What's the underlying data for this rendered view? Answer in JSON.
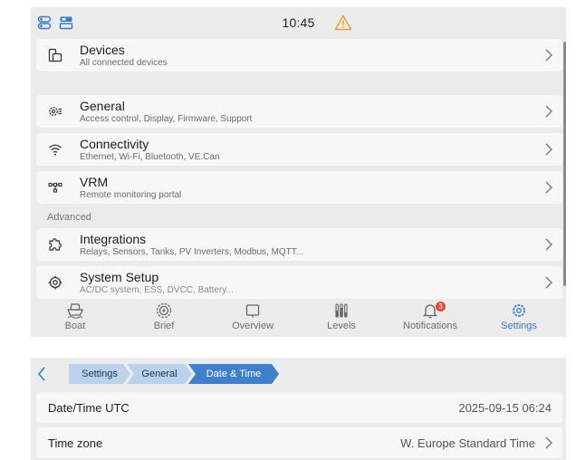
{
  "status_bar": {
    "time": "10:45",
    "icons": [
      "toggle-switches-icon",
      "panel-layout-icon",
      "warning-triangle-icon"
    ],
    "warning_color": "#f0a030"
  },
  "menu": {
    "devices": {
      "title": "Devices",
      "subtitle": "All connected devices",
      "icon": "devices-icon"
    },
    "general": {
      "title": "General",
      "subtitle": "Access control, Display, Firmware, Support",
      "icon": "gear-list-icon"
    },
    "connectivity": {
      "title": "Connectivity",
      "subtitle": "Ethernet, Wi-Fi, Bluetooth, VE.Can",
      "icon": "wifi-icon"
    },
    "vrm": {
      "title": "VRM",
      "subtitle": "Remote monitoring portal",
      "icon": "network-icon"
    },
    "advanced_label": "Advanced",
    "integrations": {
      "title": "Integrations",
      "subtitle": "Relays, Sensors, Tanks, PV Inverters, Modbus, MQTT...",
      "icon": "puzzle-icon"
    },
    "system_setup": {
      "title": "System Setup",
      "subtitle": "AC/DC system, ESS, DVCC, Battery...",
      "icon": "target-gear-icon"
    }
  },
  "nav": {
    "boat": "Boat",
    "brief": "Brief",
    "overview": "Overview",
    "levels": "Levels",
    "notifications": "Notifications",
    "notifications_badge": "3",
    "settings": "Settings",
    "active": "Settings",
    "accent_color": "#3b7bc8"
  },
  "datetime_page": {
    "breadcrumb": [
      "Settings",
      "General",
      "Date & Time"
    ],
    "rows": [
      {
        "label": "Date/Time UTC",
        "value": "2025-09-15 06:24"
      },
      {
        "label": "Time zone",
        "value": "W. Europe Standard Time"
      }
    ]
  }
}
